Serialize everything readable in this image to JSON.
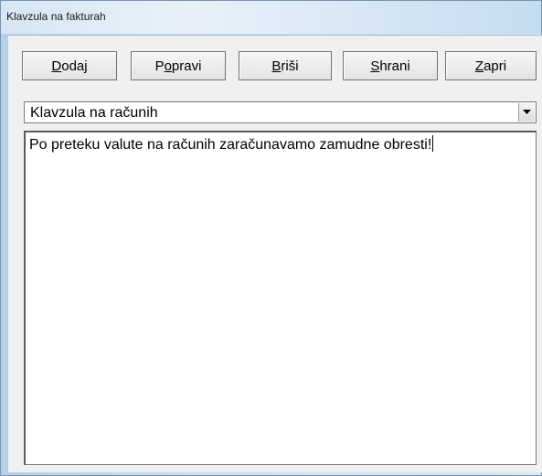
{
  "window": {
    "title": "Klavzula na fakturah"
  },
  "toolbar": {
    "buttons": [
      {
        "mnemonic": "D",
        "rest": "odaj",
        "pre": ""
      },
      {
        "pre": "P",
        "mnemonic": "o",
        "rest": "pravi"
      },
      {
        "pre": "",
        "mnemonic": "B",
        "rest": "riši"
      },
      {
        "pre": "",
        "mnemonic": "S",
        "rest": "hrani"
      },
      {
        "pre": "",
        "mnemonic": "Z",
        "rest": "apri"
      }
    ]
  },
  "clause_select": {
    "selected": "Klavzula na računih"
  },
  "clause_text": {
    "value": "Po preteku valute na računih zaračunavamo zamudne obresti!"
  },
  "icons": {
    "dropdown": "chevron-down-icon"
  }
}
